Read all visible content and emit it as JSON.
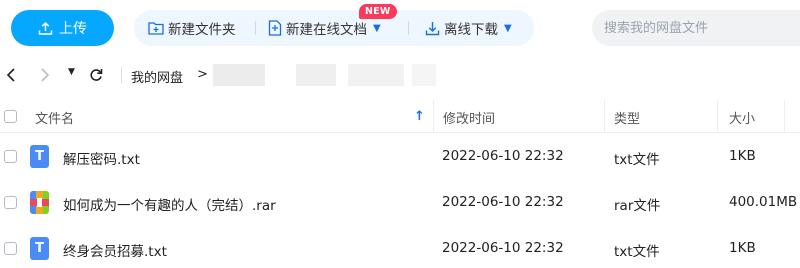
{
  "toolbar": {
    "upload_label": "上传",
    "new_folder_label": "新建文件夹",
    "new_online_doc_label": "新建在线文档",
    "new_badge": "NEW",
    "offline_download_label": "离线下载",
    "search_placeholder": "搜索我的网盘文件",
    "accent_color": "#06a7ff"
  },
  "nav": {
    "back_icon": "back-arrow",
    "forward_icon": "forward-arrow",
    "history_icon": "caret-down",
    "refresh_icon": "refresh",
    "breadcrumb_root": "我的网盘",
    "breadcrumb_sep": ">"
  },
  "table": {
    "columns": {
      "name": "文件名",
      "modified": "修改时间",
      "type": "类型",
      "size": "大小"
    },
    "sort_icon": "↑",
    "rows": [
      {
        "icon": "txt",
        "name": "解压密码.txt",
        "modified": "2022-06-10 22:32",
        "type": "txt文件",
        "size": "1KB"
      },
      {
        "icon": "rar",
        "name": "如何成为一个有趣的人（完结）.rar",
        "modified": "2022-06-10 22:32",
        "type": "rar文件",
        "size": "400.01MB"
      },
      {
        "icon": "txt",
        "name": "终身会员招募.txt",
        "modified": "2022-06-10 22:32",
        "type": "txt文件",
        "size": "1KB"
      }
    ]
  }
}
